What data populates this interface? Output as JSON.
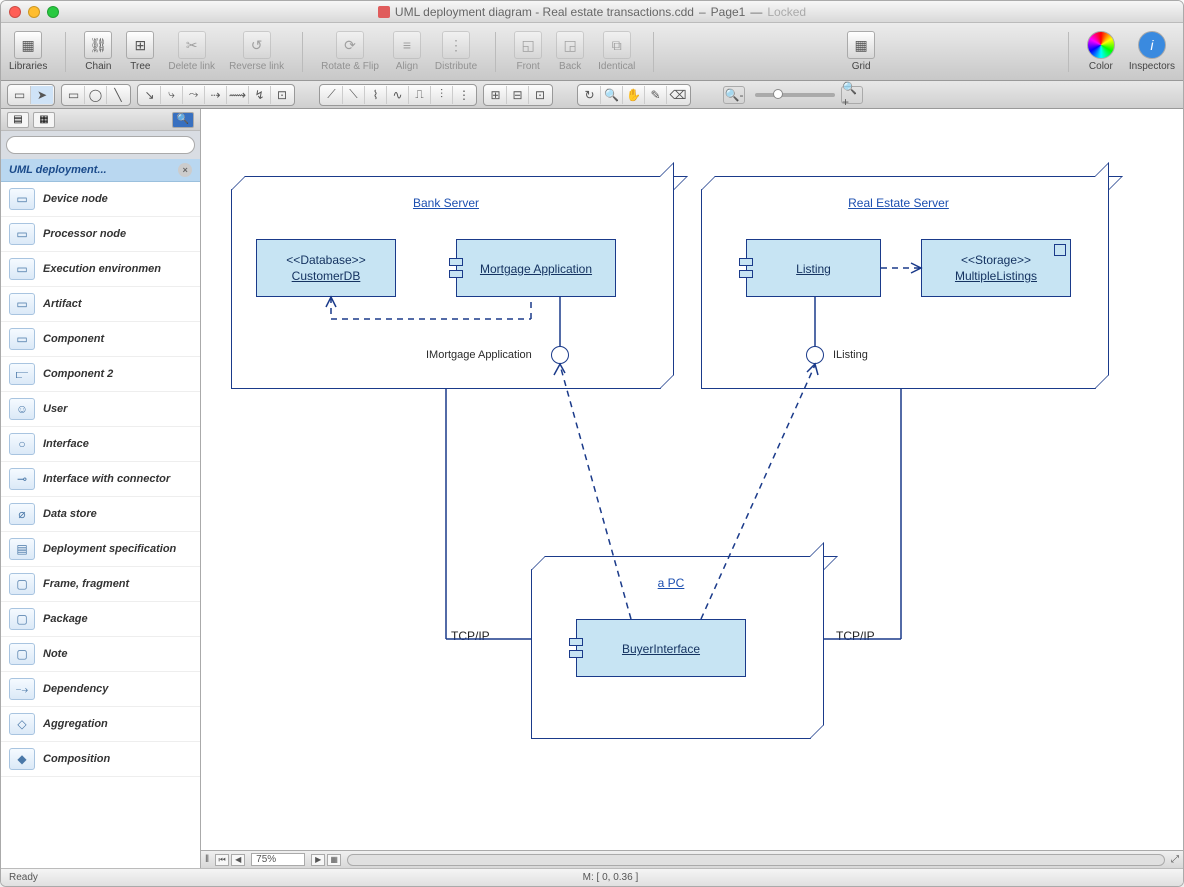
{
  "window": {
    "title_doc": "UML deployment diagram - Real estate transactions.cdd",
    "title_page": "Page1",
    "locked": "Locked"
  },
  "toolbar": {
    "libraries": "Libraries",
    "chain": "Chain",
    "tree": "Tree",
    "delete_link": "Delete link",
    "reverse_link": "Reverse link",
    "rotate_flip": "Rotate & Flip",
    "align": "Align",
    "distribute": "Distribute",
    "front": "Front",
    "back": "Back",
    "identical": "Identical",
    "grid": "Grid",
    "color": "Color",
    "inspectors": "Inspectors"
  },
  "sidebar": {
    "library_title": "UML deployment...",
    "search_placeholder": "",
    "items": [
      {
        "label": "Device node"
      },
      {
        "label": "Processor node"
      },
      {
        "label": "Execution environmen"
      },
      {
        "label": "Artifact"
      },
      {
        "label": "Component"
      },
      {
        "label": "Component 2"
      },
      {
        "label": "User"
      },
      {
        "label": "Interface"
      },
      {
        "label": "Interface with connector"
      },
      {
        "label": "Data store"
      },
      {
        "label": "Deployment specification"
      },
      {
        "label": "Frame, fragment"
      },
      {
        "label": "Package"
      },
      {
        "label": "Note"
      },
      {
        "label": "Dependency"
      },
      {
        "label": "Aggregation"
      },
      {
        "label": "Composition"
      }
    ]
  },
  "diagram": {
    "nodes": {
      "bank_server": "Bank Server",
      "real_estate_server": "Real Estate Server",
      "a_pc": "a PC"
    },
    "components": {
      "customer_db_stereo": "<<Database>>",
      "customer_db": "CustomerDB",
      "mortgage_app": "Mortgage Application",
      "listing": "Listing",
      "multiple_listings_stereo": "<<Storage>>",
      "multiple_listings": "MultipleListings",
      "buyer_interface": "BuyerInterface"
    },
    "interfaces": {
      "imortgage": "IMortgage Application",
      "ilisting": "IListing"
    },
    "protocol_left": "TCP/IP",
    "protocol_right": "TCP/IP"
  },
  "bottombar": {
    "zoom": "75%"
  },
  "status": {
    "ready": "Ready",
    "coords": "M: [ 0, 0.36 ]"
  }
}
